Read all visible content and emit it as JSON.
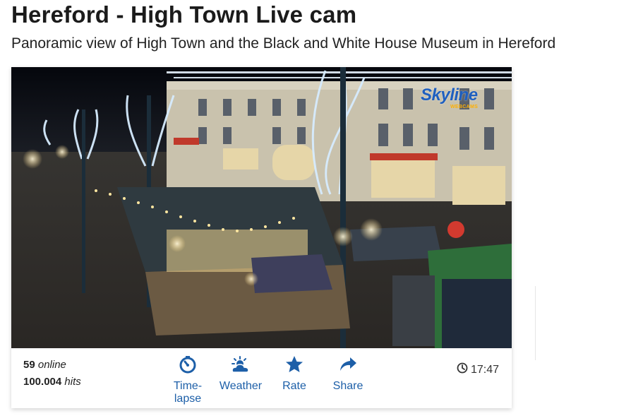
{
  "page": {
    "title": "Hereford - High Town Live cam",
    "subtitle": "Panoramic view of High Town and the Black and White House Museum in Hereford"
  },
  "cam": {
    "logo_text": "Skyline",
    "logo_sub": "WEBCAMS"
  },
  "stats": {
    "online_count": "59",
    "online_label": "online",
    "hits_count": "100.004",
    "hits_label": "hits"
  },
  "controls": [
    {
      "label_line1": "Time-",
      "label_line2": "lapse",
      "icon": "timelapse-icon"
    },
    {
      "label": "Weather",
      "icon": "weather-icon"
    },
    {
      "label": "Rate",
      "icon": "star-icon"
    },
    {
      "label": "Share",
      "icon": "share-icon"
    }
  ],
  "time": {
    "value": "17:47",
    "icon": "clock-icon"
  },
  "colors": {
    "accent": "#1d5fa8",
    "title": "#1b1b1b",
    "logo": "#1f5fbf"
  }
}
